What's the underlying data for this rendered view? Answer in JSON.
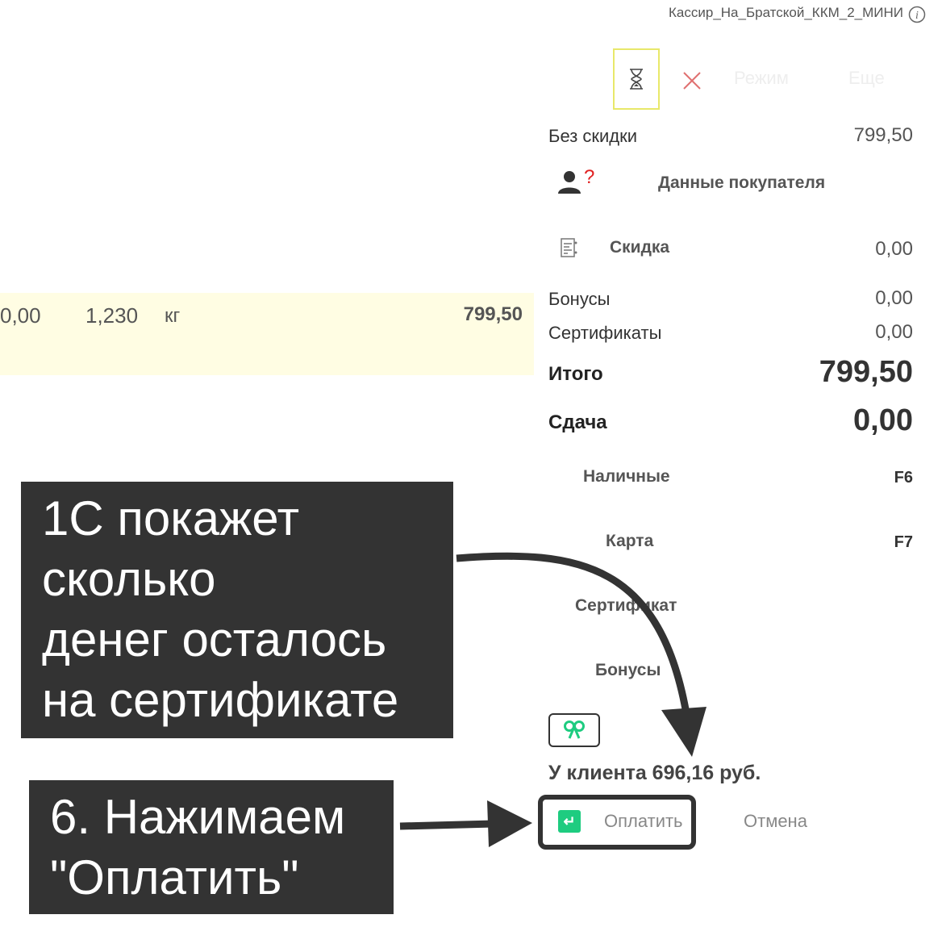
{
  "header": {
    "user_label": "Кассир_На_Братской_ККМ_2_МИНИ",
    "info_icon": "info-icon"
  },
  "toolbar": {
    "hourglass_icon": "hourglass-icon",
    "close_icon": "close-icon",
    "mode_label": "Режим",
    "more_label": "Еще"
  },
  "product_row": {
    "price_partial": "0,00",
    "quantity": "1,230",
    "unit": "кг",
    "sum": "799,50"
  },
  "summary": {
    "no_discount_label": "Без скидки",
    "no_discount_value": "799,50",
    "customer_data_label": "Данные покупателя",
    "customer_question": "?",
    "discount_label": "Скидка",
    "discount_value": "0,00",
    "bonuses_label": "Бонусы",
    "bonuses_value": "0,00",
    "certificates_label": "Сертификаты",
    "certificates_value": "0,00",
    "total_label": "Итого",
    "total_value": "799,50",
    "change_label": "Сдача",
    "change_value": "0,00"
  },
  "payment_methods": [
    {
      "label": "Наличные",
      "key": "F6"
    },
    {
      "label": "Карта",
      "key": "F7"
    },
    {
      "label": "Сертификат",
      "key": ""
    },
    {
      "label": "Бонусы",
      "key": ""
    }
  ],
  "certificate": {
    "gift_icon": "gift-icon",
    "client_balance": "У клиента 696,16 руб."
  },
  "actions": {
    "pay_label": "Оплатить",
    "cancel_label": "Отмена"
  },
  "callouts": {
    "first": [
      "1С покажет",
      "сколько",
      "денег осталось",
      "на сертификате"
    ],
    "second": [
      "6. Нажимаем",
      "\"Оплатить\""
    ]
  },
  "colors": {
    "callout_bg": "#333333",
    "row_highlight": "#fffde3",
    "pay_icon": "#1ecc80",
    "toolbar_highlight": "#e8e86a",
    "close_red": "#e07070"
  }
}
